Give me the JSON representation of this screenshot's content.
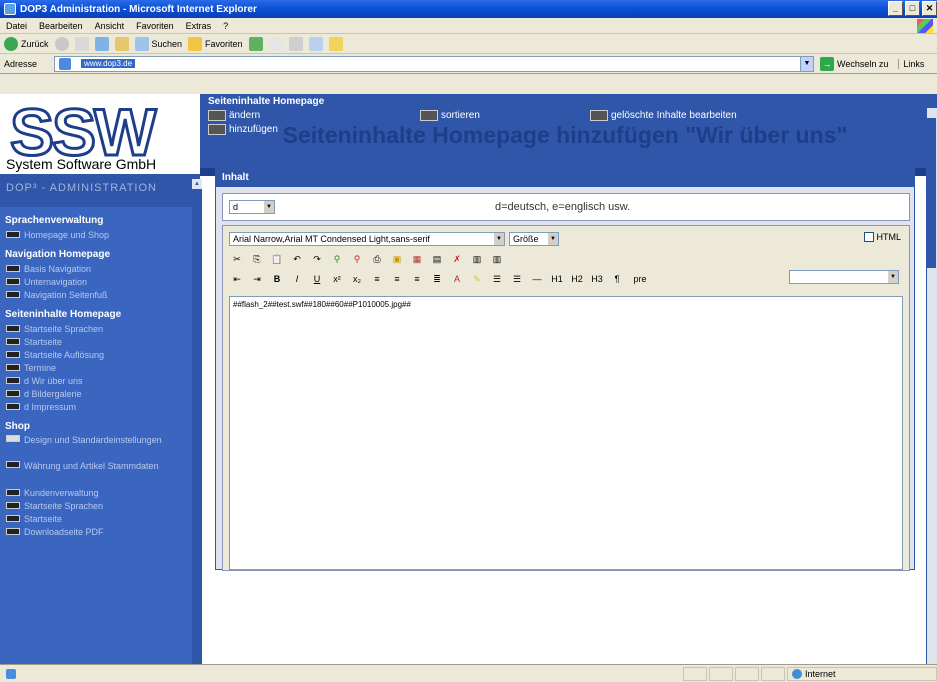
{
  "window": {
    "title": "DOP3 Administration - Microsoft Internet Explorer",
    "buttons": [
      "_",
      "□",
      "✕"
    ]
  },
  "menu": [
    "Datei",
    "Bearbeiten",
    "Ansicht",
    "Favoriten",
    "Extras",
    "?"
  ],
  "toolbar": {
    "back": "Zurück",
    "search": "Suchen",
    "favorites": "Favoriten"
  },
  "address": {
    "label": "Adresse",
    "url": "www.dop3.de",
    "go_label": "Wechseln zu",
    "links_label": "Links"
  },
  "header": {
    "logo_text": "SSW",
    "company": "System Software GmbH",
    "section_title": "Seiteninhalte Homepage",
    "actions": {
      "change": "ändern",
      "add": "hinzufügen",
      "sort": "sortieren",
      "deleted": "gelöschte Inhalte bearbeiten"
    }
  },
  "sidebar": {
    "admin_label": "DOP³ - ADMINISTRATION",
    "sections": [
      {
        "title": "Sprachenverwaltung",
        "items": [
          "Homepage und Shop"
        ]
      },
      {
        "title": "Navigation Homepage",
        "items": [
          "Basis Navigation",
          "Unternavigation",
          "Navigation Seitenfuß"
        ]
      },
      {
        "title": "Seiteninhalte Homepage",
        "items": [
          "Startseite Sprachen",
          "Startseite",
          "Startseite Auflösung",
          "Termine",
          "d Wir über uns",
          "d Bildergalerie",
          "d Impressum"
        ]
      },
      {
        "title": "Shop",
        "items": [
          "Design und Standardeinstellungen",
          "Währung und Artikel Stammdaten",
          "Kundenverwaltung",
          "Startseite Sprachen",
          "Startseite",
          "Downloadseite PDF"
        ]
      }
    ]
  },
  "main": {
    "page_title": "Seiteninhalte Homepage hinzufügen \"Wir über uns\"",
    "panel_title": "Inhalt",
    "language_value": "d",
    "language_hint": "d=deutsch, e=englisch usw.",
    "font_select": "Arial Narrow,Arial MT Condensed Light,sans-serif",
    "size_select": "Größe",
    "html_label": "HTML",
    "heading_buttons": [
      "H1",
      "H2",
      "H3"
    ],
    "pre_label": "pre",
    "editor_content": "##flash_2##test.swf##180##60##P1010005.jpg##"
  },
  "status": {
    "zone": "Internet"
  }
}
